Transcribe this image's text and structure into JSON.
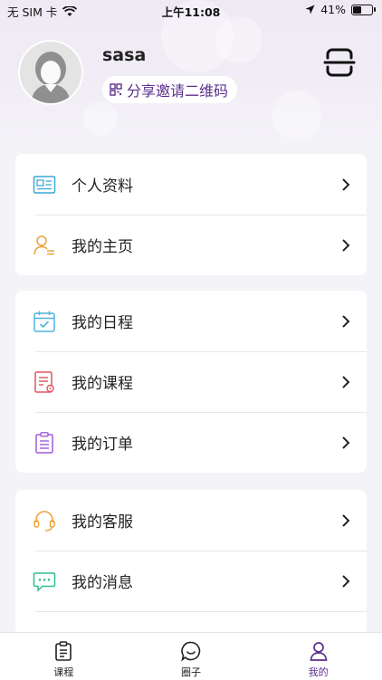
{
  "status_bar": {
    "carrier": "无 SIM 卡",
    "time": "上午11:08",
    "battery": "41%",
    "battery_level": 0.41
  },
  "profile": {
    "username": "sasa",
    "share_label": "分享邀请二维码"
  },
  "menu_groups": [
    {
      "items": [
        {
          "label": "个人资料",
          "icon": "id-card-icon"
        },
        {
          "label": "我的主页",
          "icon": "user-profile-icon"
        }
      ]
    },
    {
      "items": [
        {
          "label": "我的日程",
          "icon": "calendar-icon"
        },
        {
          "label": "我的课程",
          "icon": "course-document-icon"
        },
        {
          "label": "我的订单",
          "icon": "order-clipboard-icon"
        }
      ]
    },
    {
      "items": [
        {
          "label": "我的客服",
          "icon": "headset-icon"
        },
        {
          "label": "我的消息",
          "icon": "message-icon"
        }
      ]
    }
  ],
  "tabbar": {
    "items": [
      {
        "label": "课程",
        "icon": "clipboard-icon",
        "active": false
      },
      {
        "label": "圈子",
        "icon": "chat-bubble-icon",
        "active": false
      },
      {
        "label": "我的",
        "icon": "person-icon",
        "active": true
      }
    ]
  },
  "colors": {
    "accent": "#5b2f8d",
    "background": "#f4f3f8"
  }
}
